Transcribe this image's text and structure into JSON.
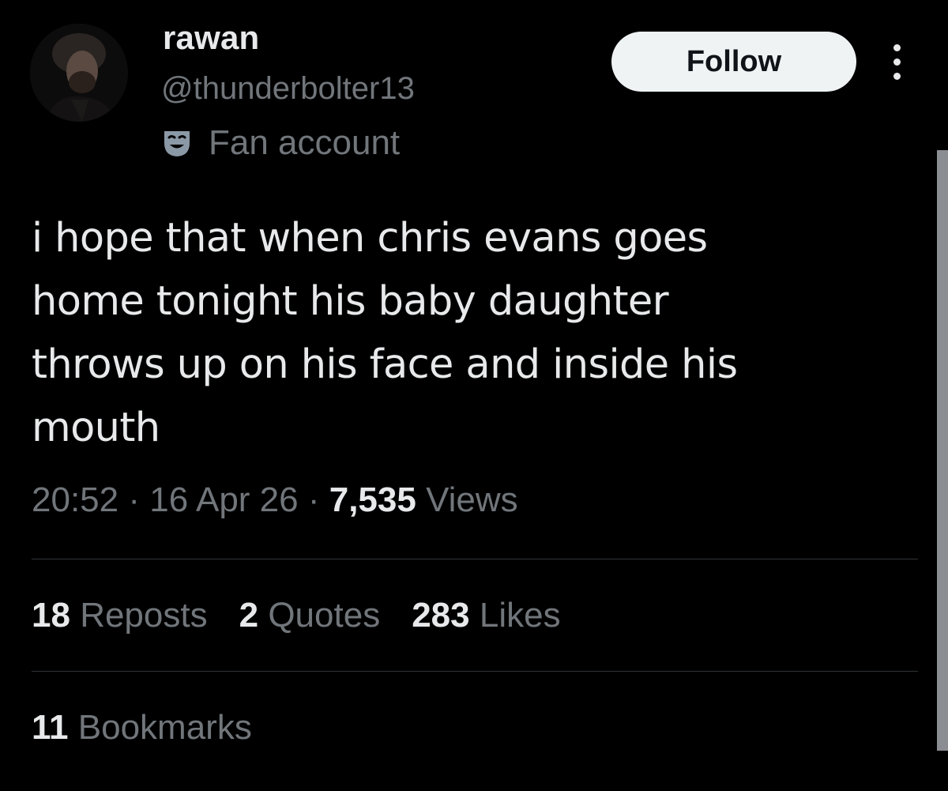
{
  "user": {
    "display_name": "rawan",
    "handle": "@thunderbolter13",
    "label": "Fan account",
    "label_icon": "theater-mask-icon",
    "avatar": "profile-photo"
  },
  "actions": {
    "follow_label": "Follow",
    "more_icon": "more-vertical-icon"
  },
  "tweet": {
    "text": "i hope that when chris evans goes\nhome tonight his baby daughter\nthrows up on his face and inside his\nmouth"
  },
  "meta": {
    "time": "20:52",
    "date": "16 Apr 26",
    "separator": "·",
    "views_count": "7,535",
    "views_label": "Views"
  },
  "stats": {
    "reposts_count": "18",
    "reposts_label": "Reposts",
    "quotes_count": "2",
    "quotes_label": "Quotes",
    "likes_count": "283",
    "likes_label": "Likes",
    "bookmarks_count": "11",
    "bookmarks_label": "Bookmarks"
  },
  "colors": {
    "background": "#000000",
    "primary_text": "#e7e9ea",
    "secondary_text": "#71767b",
    "divider": "#2f3336",
    "follow_button_bg": "#eff3f4"
  }
}
